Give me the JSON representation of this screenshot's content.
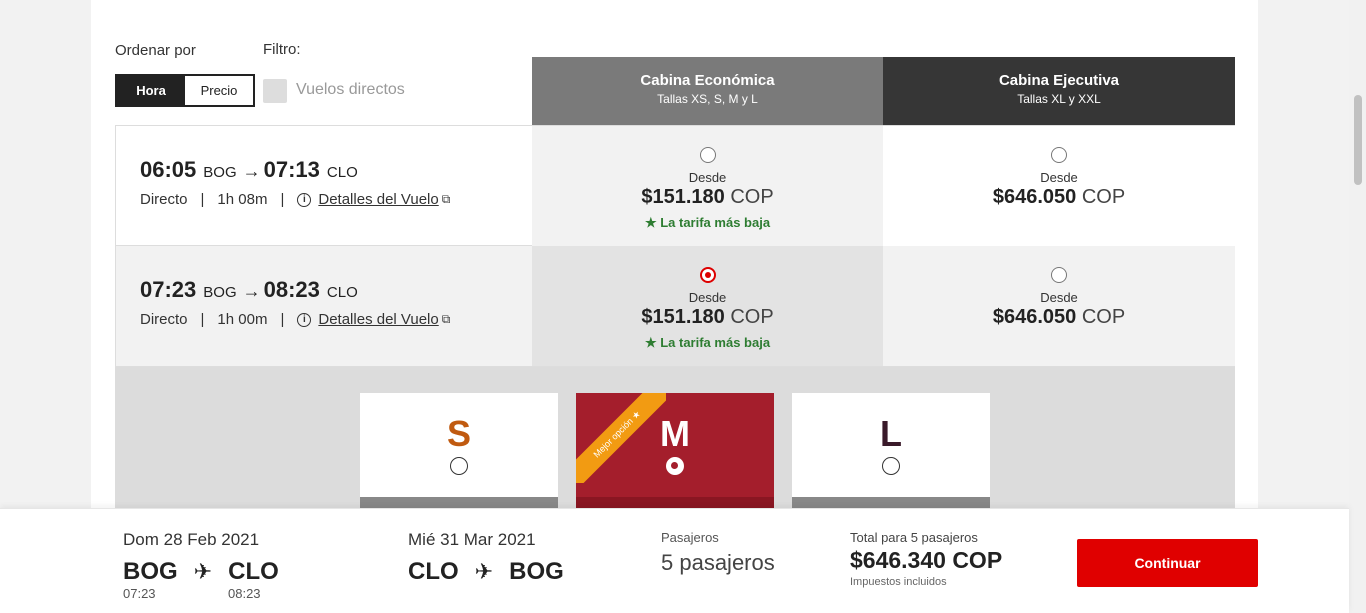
{
  "controls": {
    "sort_label": "Ordenar por",
    "filter_label": "Filtro:",
    "sort_options": [
      "Hora",
      "Precio"
    ],
    "active_sort": "Hora",
    "direct_label": "Vuelos directos"
  },
  "cabins": [
    {
      "title": "Cabina Económica",
      "subtitle": "Tallas XS, S, M y L"
    },
    {
      "title": "Cabina Ejecutiva",
      "subtitle": "Tallas XL y XXL"
    }
  ],
  "flights": [
    {
      "dep_time": "06:05",
      "dep_airport": "BOG",
      "arr_time": "07:13",
      "arr_airport": "CLO",
      "type": "Directo",
      "duration": "1h 08m",
      "details_label": "Detalles del Vuelo",
      "econ": {
        "desde": "Desde",
        "price": "$151.180",
        "currency": "COP",
        "note": "★ La tarifa más baja",
        "selected": false
      },
      "exec": {
        "desde": "Desde",
        "price": "$646.050",
        "currency": "COP",
        "selected": false
      }
    },
    {
      "dep_time": "07:23",
      "dep_airport": "BOG",
      "arr_time": "08:23",
      "arr_airport": "CLO",
      "type": "Directo",
      "duration": "1h 00m",
      "details_label": "Detalles del Vuelo",
      "econ": {
        "desde": "Desde",
        "price": "$151.180",
        "currency": "COP",
        "note": "★ La tarifa más baja",
        "selected": true
      },
      "exec": {
        "desde": "Desde",
        "price": "$646.050",
        "currency": "COP",
        "selected": false
      }
    }
  ],
  "sizes": [
    {
      "letter": "S",
      "selected": false
    },
    {
      "letter": "M",
      "selected": true,
      "ribbon": "Mejor opción ★"
    },
    {
      "letter": "L",
      "selected": false
    }
  ],
  "footer": {
    "outbound": {
      "date": "Dom 28 Feb 2021",
      "from": "BOG",
      "to": "CLO",
      "dep": "07:23",
      "arr": "08:23"
    },
    "return": {
      "date": "Mié 31 Mar 2021",
      "from": "CLO",
      "to": "BOG"
    },
    "passengers_label": "Pasajeros",
    "passengers_value": "5 pasajeros",
    "total_label": "Total para 5 pasajeros",
    "total_amount": "$646.340 COP",
    "tax_note": "Impuestos incluidos",
    "continue_label": "Continuar"
  },
  "colors": {
    "accent": "#e00000",
    "selected_size": "#a41e2c",
    "lowest_fare": "#2e7d32",
    "ribbon": "#f29b12"
  }
}
